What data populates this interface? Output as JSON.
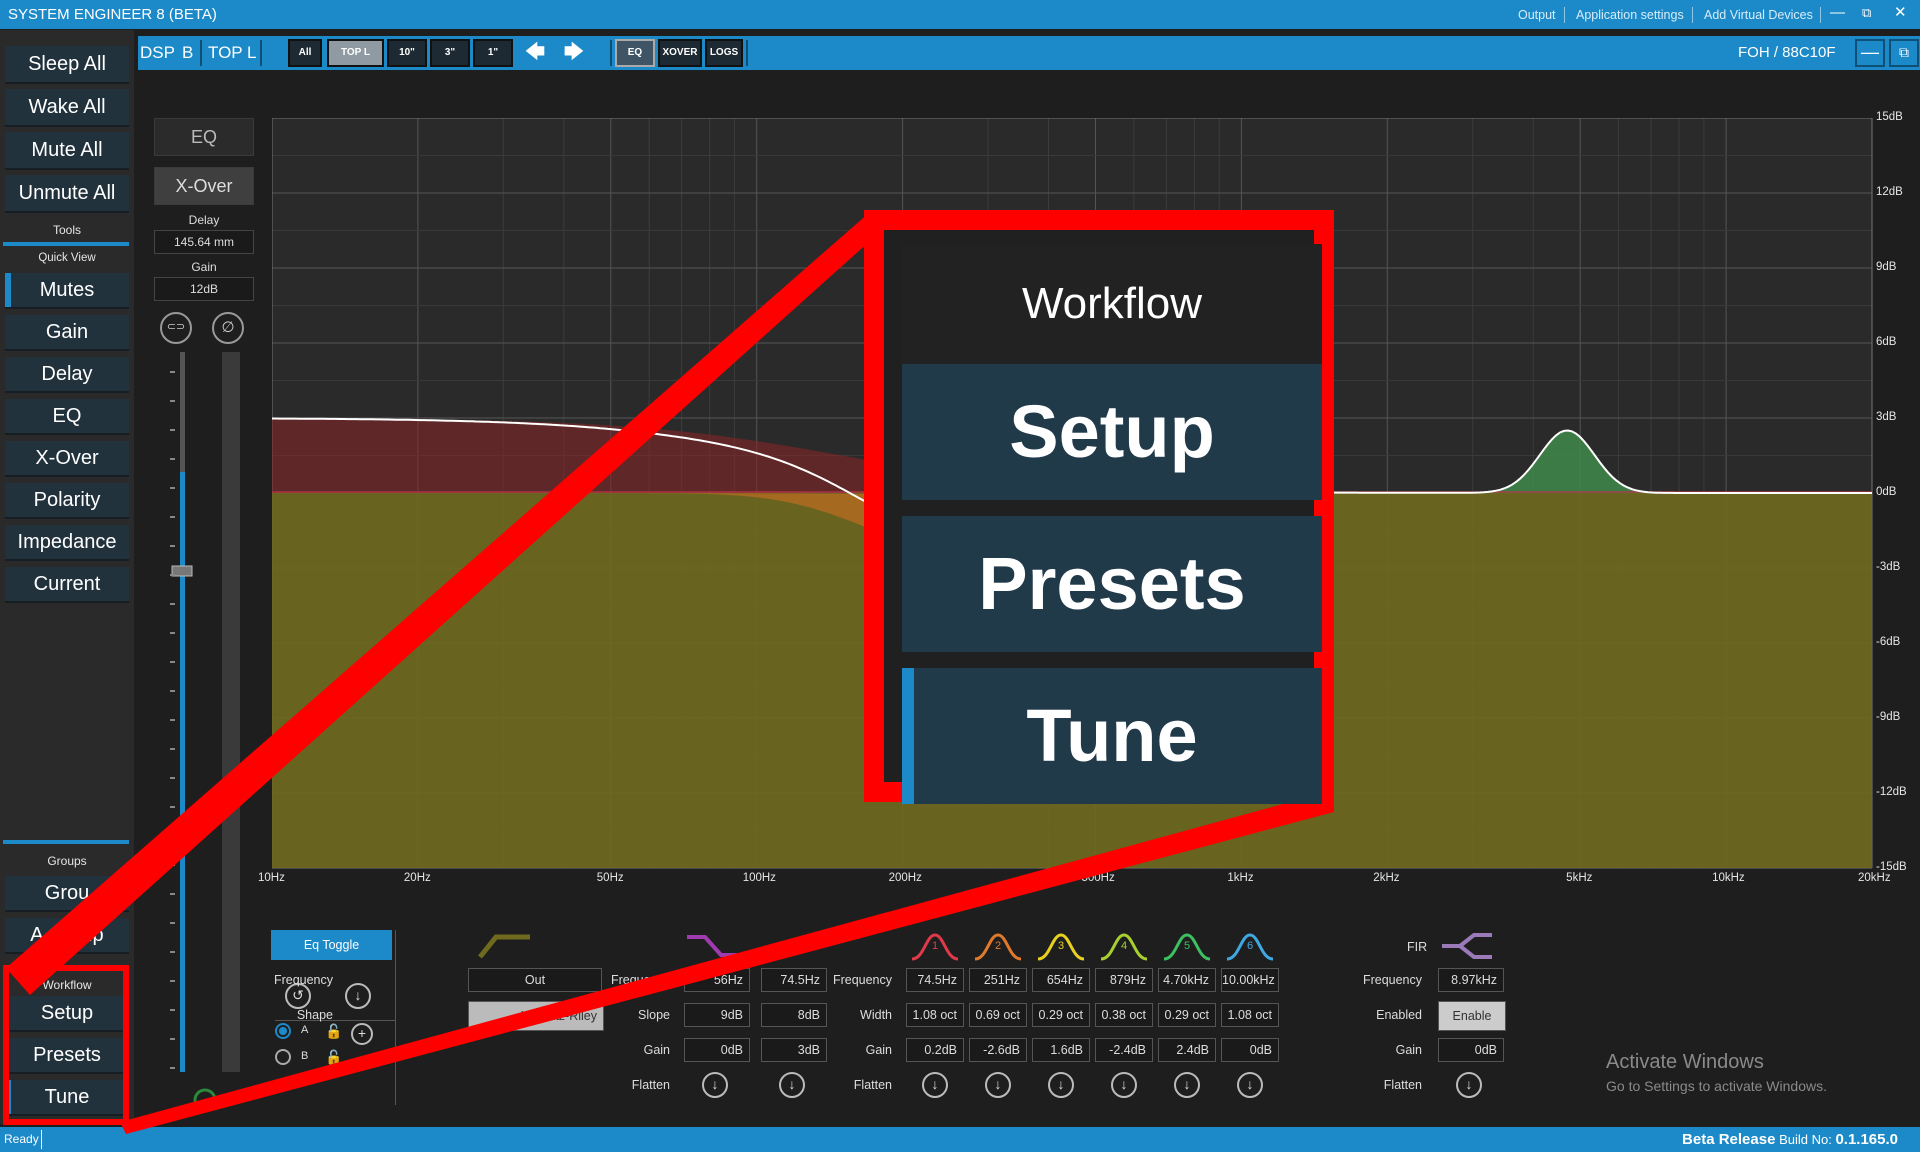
{
  "window": {
    "title": "SYSTEM ENGINEER 8 (BETA)",
    "menu": [
      "Output",
      "Application settings",
      "Add Virtual Devices"
    ],
    "controls": {
      "minimize": "—",
      "restore": "⧉",
      "close": "✕"
    }
  },
  "sidebar": {
    "global_buttons": [
      "Sleep All",
      "Wake All",
      "Mute All",
      "Unmute All"
    ],
    "tools_label": "Tools",
    "quick_view_label": "Quick View",
    "quick_view": [
      "Mutes",
      "Gain",
      "Delay",
      "EQ",
      "X-Over",
      "Polarity",
      "Impedance",
      "Current"
    ],
    "groups_label": "Groups",
    "groups": [
      "Grou",
      "A Group"
    ],
    "workflow_label": "Workflow",
    "workflow": [
      "Setup",
      "Presets",
      "Tune"
    ]
  },
  "toolbar": {
    "device": "DSP",
    "channel_letter": "B",
    "channel_name": "TOP L",
    "tabs": [
      "All",
      "TOP L",
      "10\"",
      "3\"",
      "1\""
    ],
    "prev_arrow": "🡄",
    "next_arrow": "🡆",
    "view_buttons": [
      "EQ",
      "XOVER",
      "LOGS"
    ],
    "device_id": "FOH / 88C10F",
    "min_btn": "—",
    "max_btn": "⧉"
  },
  "strip": {
    "eq_button": "EQ",
    "xover_button": "X-Over",
    "delay_label": "Delay",
    "delay_value": "145.64 mm",
    "gain_label": "Gain",
    "gain_value": "12dB",
    "link_icon": "⊂⊃",
    "phase_icon": "∅"
  },
  "graph": {
    "y_labels": [
      "15dB",
      "12dB",
      "9dB",
      "6dB",
      "3dB",
      "0dB",
      "-3dB",
      "-6dB",
      "-9dB",
      "-12dB",
      "-15dB"
    ],
    "x_labels": [
      "10Hz",
      "20Hz",
      "50Hz",
      "100Hz",
      "200Hz",
      "500Hz",
      "1kHz",
      "2kHz",
      "5kHz",
      "10kHz",
      "20kHz"
    ]
  },
  "panel": {
    "eq_toggle": "Eq Toggle",
    "preset_a": "A",
    "preset_b": "B",
    "xover_freq_label": "Frequency",
    "xover_freq": "Out",
    "xover_shape_label": "Shape",
    "xover_shape": "Linkwitz-Riley",
    "shelf_frequency_label": "Frequency",
    "shelf_slope_label": "Slope",
    "shelf_gain_label": "Gain",
    "shelf_flatten_label": "Flatten",
    "shelf1": {
      "freq": "56Hz",
      "slope": "9dB",
      "gain": "0dB"
    },
    "shelf2": {
      "freq": "74.5Hz",
      "slope": "8dB",
      "gain": "3dB"
    },
    "peq_freq_label": "Frequency",
    "peq_width_label": "Width",
    "peq_gain_label": "Gain",
    "peq_flatten_label": "Flatten",
    "bands": [
      {
        "num": "1",
        "color": "#e03a4a",
        "freq": "74.5Hz",
        "width": "1.08 oct",
        "gain": "0.2dB"
      },
      {
        "num": "2",
        "color": "#e07a2a",
        "freq": "251Hz",
        "width": "0.69 oct",
        "gain": "-2.6dB"
      },
      {
        "num": "3",
        "color": "#e8d020",
        "freq": "654Hz",
        "width": "0.29 oct",
        "gain": "1.6dB"
      },
      {
        "num": "4",
        "color": "#a8d030",
        "freq": "879Hz",
        "width": "0.38 oct",
        "gain": "-2.4dB"
      },
      {
        "num": "5",
        "color": "#3cc060",
        "freq": "4.70kHz",
        "width": "0.29 oct",
        "gain": "2.4dB"
      },
      {
        "num": "6",
        "color": "#40a8e0",
        "freq": "10.00kHz",
        "width": "1.08 oct",
        "gain": "0dB"
      }
    ],
    "fir_label": "FIR",
    "fir_freq_label": "Frequency",
    "fir_freq": "8.97kHz",
    "fir_enabled_label": "Enabled",
    "fir_enable_button": "Enable",
    "fir_gain_label": "Gain",
    "fir_gain": "0dB",
    "fir_flatten_label": "Flatten"
  },
  "watermark": {
    "line1": "Activate Windows",
    "line2": "Go to Settings to activate Windows."
  },
  "status": {
    "ready": "Ready",
    "release": "Beta Release",
    "build_label": "Build No:",
    "build_no": "0.1.165.0"
  },
  "callout": {
    "title": "Workflow",
    "items": [
      "Setup",
      "Presets",
      "Tune"
    ],
    "highlight_color": "#ff0000"
  }
}
